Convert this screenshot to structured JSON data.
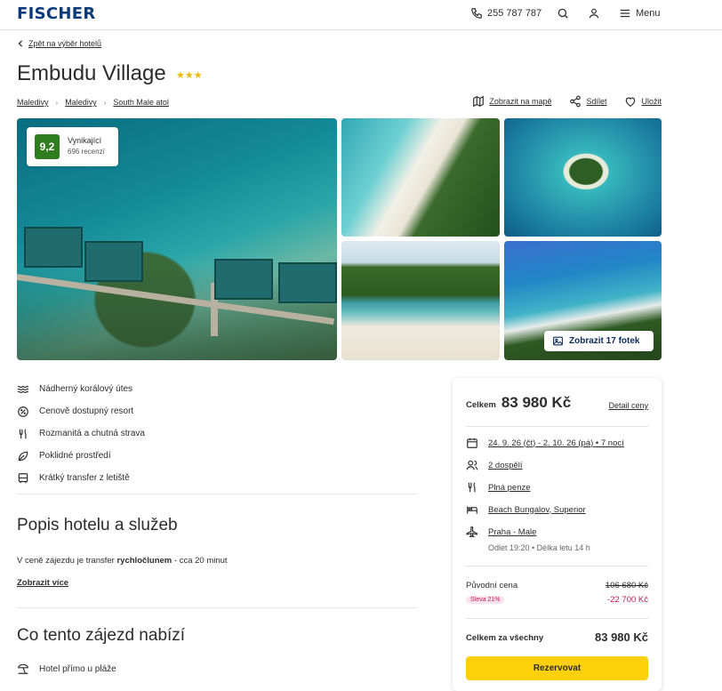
{
  "header": {
    "logo": "FISCHER",
    "phone": "255 787 787",
    "menu_label": "Menu"
  },
  "back_link": "Zpět na výběr hotelů",
  "hotel": {
    "name": "Embudu Village",
    "stars": "★★★",
    "breadcrumbs": [
      "Maledivy",
      "Maledivy",
      "South Male atol"
    ]
  },
  "actions": {
    "map": "Zobrazit na mapě",
    "share": "Sdílet",
    "save": "Uložit"
  },
  "rating": {
    "score": "9,2",
    "label": "Vynikající",
    "count": "696 recenzí"
  },
  "gallery": {
    "show_photos": "Zobrazit 17 fotek"
  },
  "features": [
    {
      "icon": "waves-icon",
      "label": "Nádherný korálový útes"
    },
    {
      "icon": "discount-icon",
      "label": "Cenově dostupný resort"
    },
    {
      "icon": "cutlery-icon",
      "label": "Rozmanitá a chutná strava"
    },
    {
      "icon": "leaf-icon",
      "label": "Poklidné prostředí"
    },
    {
      "icon": "bus-icon",
      "label": "Krátký transfer z letiště"
    }
  ],
  "description": {
    "title": "Popis hotelu a služeb",
    "text_before": "V ceně zájezdu je transfer ",
    "text_bold": "rychločlunem",
    "text_after": " - cca 20 minut",
    "more": "Zobrazit více"
  },
  "offers": {
    "title": "Co tento zájezd nabízí",
    "items": [
      {
        "icon": "beach-umbrella-icon",
        "label": "Hotel přímo u pláže"
      }
    ]
  },
  "booking": {
    "total_label": "Celkem",
    "total_value": "83 980 Kč",
    "detail_link": "Detail ceny",
    "dates": "24. 9. 26 (čt) - 2. 10. 26 (pá) • 7 nocí",
    "persons": "2 dospělí",
    "board": "Plná penze",
    "room": "Beach Bungalov, Superior",
    "flight": "Praha - Male",
    "flight_details": "Odlet 19:20 • Délka letu 14 h",
    "original_label": "Původní cena",
    "original_price": "106 680 Kč",
    "discount_tag": "Sleva 21%",
    "discount_value": "-22 700 Kč",
    "sum_label": "Celkem za všechny",
    "sum_value": "83 980 Kč",
    "reserve_button": "Rezervovat"
  },
  "colors": {
    "brand": "#0b3b7a",
    "rating_green": "#2f7d1e",
    "cta_yellow": "#fdd10a",
    "discount_pink": "#c2185b",
    "stars": "#f2b705"
  }
}
